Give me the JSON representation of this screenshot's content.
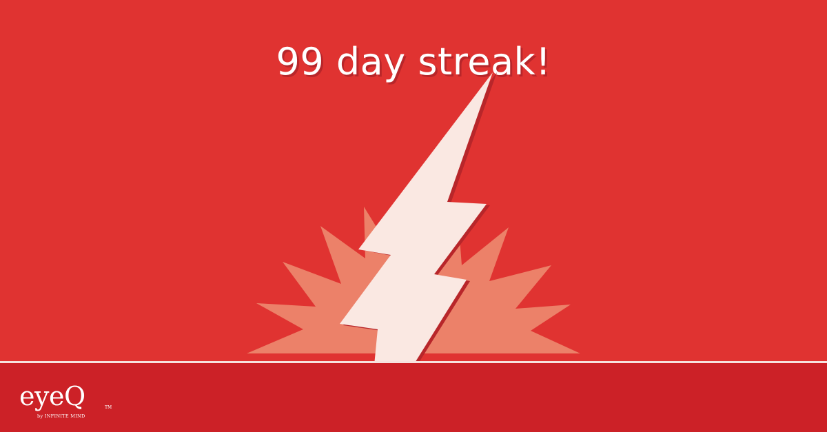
{
  "headline": "99 day streak!",
  "icons": {
    "burst": "burst-icon",
    "bolt": "lightning-bolt-icon"
  },
  "logo": {
    "wordmark": "eyeQ",
    "trademark": "TM",
    "tagline": "by INFINITE MIND"
  },
  "colors": {
    "background": "#e03331",
    "footer": "#cc2127",
    "burst": "#ec8169",
    "bolt": "#fae8e2",
    "bolt_shadow": "#b8262a",
    "text": "#ffffff"
  }
}
